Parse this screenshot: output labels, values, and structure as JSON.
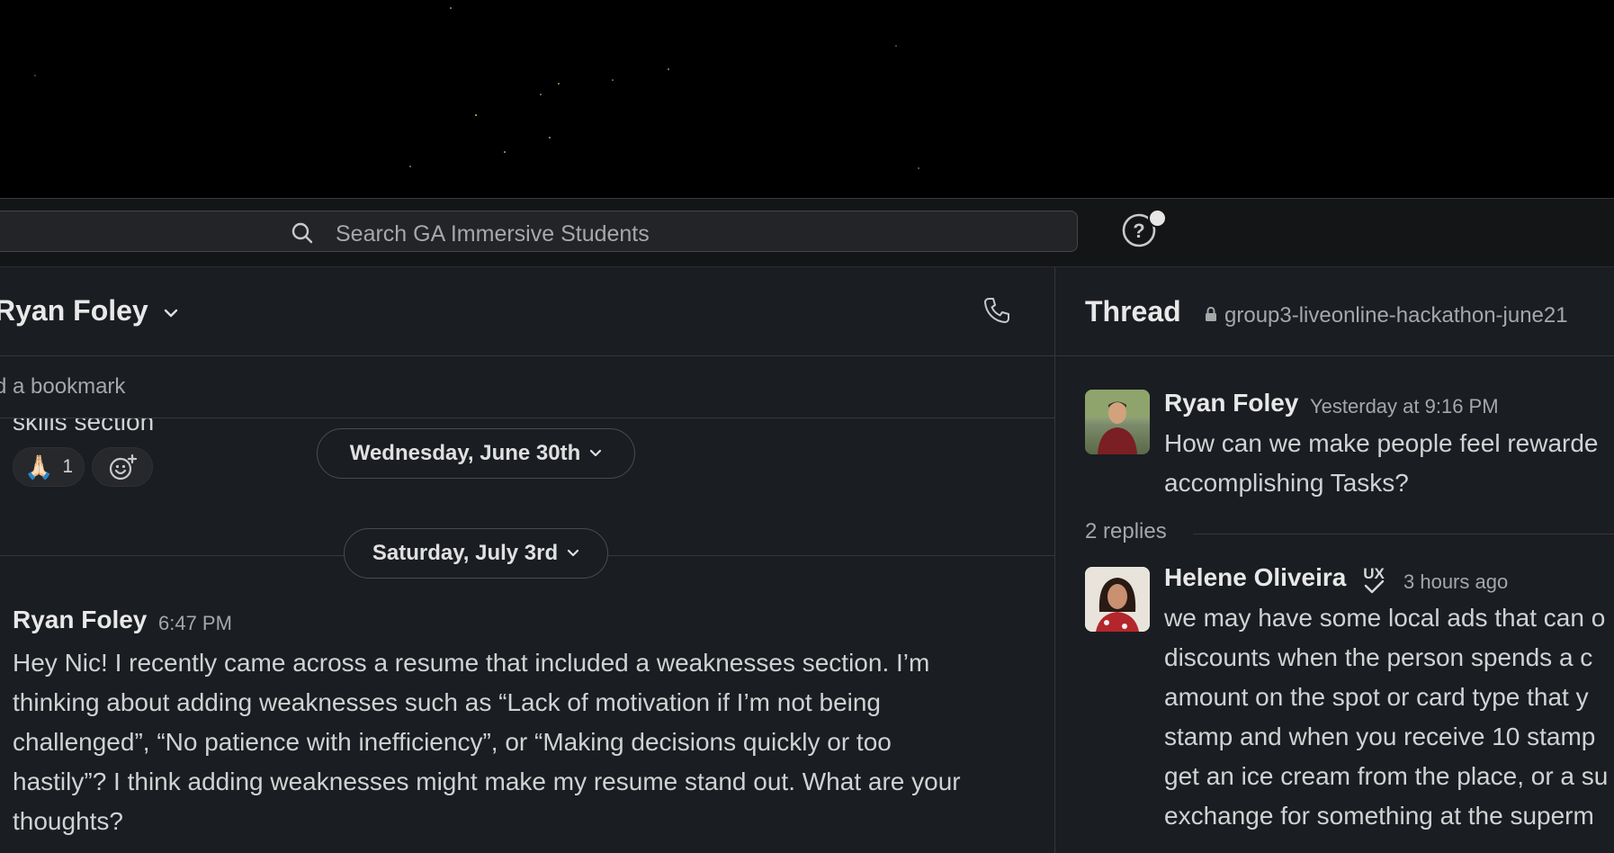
{
  "search": {
    "placeholder": "Search GA Immersive Students"
  },
  "channel": {
    "name": "Ryan Foley"
  },
  "bookmark": {
    "text": "d a bookmark"
  },
  "previous_message": {
    "text_fragment": "skills section",
    "reaction_emoji": "🙏🏻",
    "reaction_count": "1"
  },
  "dates": {
    "first": "Wednesday, June 30th",
    "second": "Saturday, July 3rd"
  },
  "message": {
    "author": "Ryan Foley",
    "time": "6:47 PM",
    "lines": [
      "Hey Nic! I recently came across a resume that included a weaknesses section. I’m",
      "thinking about adding weaknesses such as “Lack of motivation if I’m not being",
      "challenged”, “No patience with inefficiency”, or “Making decisions quickly or too",
      "hastily”? I think adding weaknesses might make my resume stand out. What are your",
      "thoughts?"
    ]
  },
  "thread": {
    "title": "Thread",
    "channel": "group3-liveonline-hackathon-june21",
    "parent": {
      "author": "Ryan Foley",
      "time": "Yesterday at 9:16 PM",
      "lines": [
        "How can we make people feel rewarde",
        "accomplishing Tasks?"
      ]
    },
    "replies_label": "2 replies",
    "reply": {
      "author": "Helene Oliveira",
      "badge": "UX",
      "time": "3 hours ago",
      "lines": [
        "we may have some local ads that can o",
        "discounts when the person spends a c",
        "amount on the spot or card type that y",
        "stamp and when you receive 10 stamp",
        "get an ice cream from the place, or a su",
        "exchange for something at the superm"
      ]
    }
  },
  "colors": {
    "background": "#1a1d21",
    "topbar": "#141517",
    "text": "#d1d2d3",
    "muted": "#a6a7a9"
  }
}
